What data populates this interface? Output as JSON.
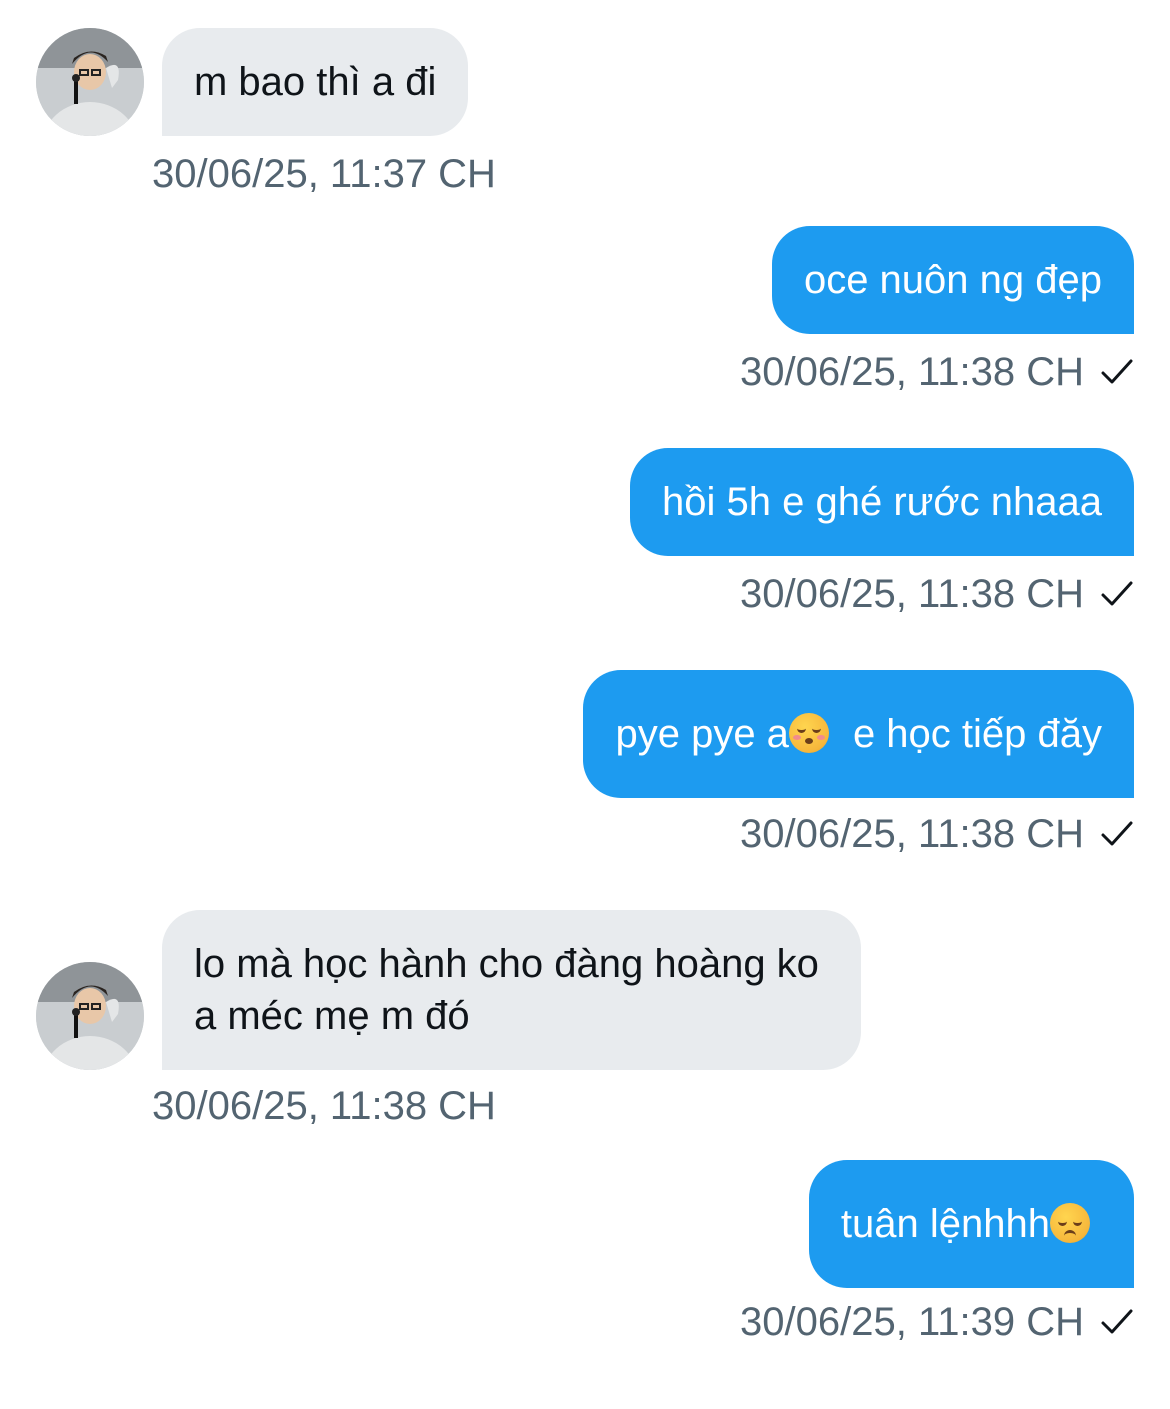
{
  "conversation": {
    "messages": [
      {
        "direction": "incoming",
        "text": "m bao thì a đi",
        "time": "30/06/25, 11:37 CH"
      },
      {
        "direction": "outgoing",
        "text": "oce nuôn ng đẹp",
        "time": "30/06/25, 11:38 CH",
        "status": "sent"
      },
      {
        "direction": "outgoing",
        "text": "hồi 5h e ghé rước nhaaa",
        "time": "30/06/25, 11:38 CH",
        "status": "sent"
      },
      {
        "direction": "outgoing",
        "text_before_emoji": "pye pye a",
        "emoji": "kissing-face-emoji",
        "text_after_emoji": "e học tiếp đăy",
        "time": "30/06/25, 11:38 CH",
        "status": "sent"
      },
      {
        "direction": "incoming",
        "line1": "lo mà học hành cho đàng hoàng ko",
        "line2": "a méc mẹ m đó",
        "time": "30/06/25, 11:38 CH"
      },
      {
        "direction": "outgoing",
        "text_before_emoji": "tuân lệnhhh",
        "emoji": "pensive-face-emoji",
        "time": "30/06/25, 11:39 CH",
        "status": "sent"
      }
    ]
  },
  "colors": {
    "outgoing_bubble": "#1d9bf0",
    "incoming_bubble": "#e8ebee",
    "timestamp": "#536471",
    "text_dark": "#0f1419"
  },
  "icons": {
    "avatar": "user-avatar-photo",
    "status": "checkmark-icon"
  }
}
